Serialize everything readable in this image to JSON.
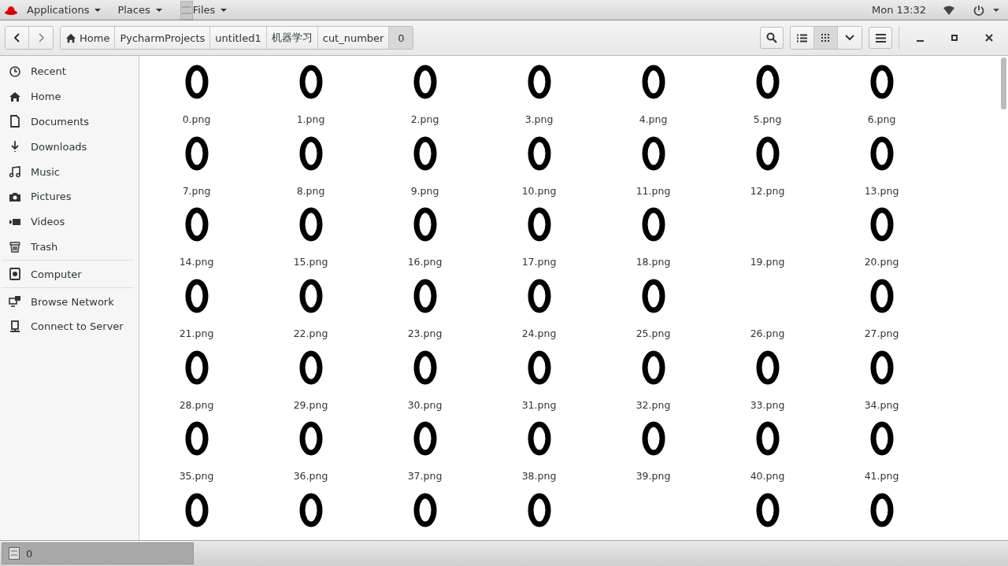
{
  "top_bar": {
    "menus": [
      {
        "label": "Applications"
      },
      {
        "label": "Places"
      },
      {
        "label": "Files"
      }
    ],
    "clock": "Mon 13:32"
  },
  "path_bar": [
    {
      "label": "Home",
      "selected": false
    },
    {
      "label": "PycharmProjects",
      "selected": false
    },
    {
      "label": "untitled1",
      "selected": false
    },
    {
      "label": "机器学习",
      "selected": false
    },
    {
      "label": "cut_number",
      "selected": false
    },
    {
      "label": "0",
      "selected": true
    }
  ],
  "view_buttons": [
    {
      "selected": false
    },
    {
      "selected": true
    }
  ],
  "sidebar": {
    "sections": [
      [
        {
          "label": "Recent"
        },
        {
          "label": "Home"
        },
        {
          "label": "Documents"
        },
        {
          "label": "Downloads"
        },
        {
          "label": "Music"
        },
        {
          "label": "Pictures"
        },
        {
          "label": "Videos"
        },
        {
          "label": "Trash"
        }
      ],
      [
        {
          "label": "Computer"
        }
      ],
      [
        {
          "label": "Browse Network"
        },
        {
          "label": "Connect to Server"
        }
      ]
    ]
  },
  "files": [
    {
      "name": "0.png",
      "kind": "digit"
    },
    {
      "name": "1.png",
      "kind": "digit"
    },
    {
      "name": "2.png",
      "kind": "digit"
    },
    {
      "name": "3.png",
      "kind": "digit"
    },
    {
      "name": "4.png",
      "kind": "digit"
    },
    {
      "name": "5.png",
      "kind": "digit"
    },
    {
      "name": "6.png",
      "kind": "digit"
    },
    {
      "name": "7.png",
      "kind": "digit"
    },
    {
      "name": "8.png",
      "kind": "digit"
    },
    {
      "name": "9.png",
      "kind": "digit"
    },
    {
      "name": "10.png",
      "kind": "digit"
    },
    {
      "name": "11.png",
      "kind": "digit"
    },
    {
      "name": "12.png",
      "kind": "digit"
    },
    {
      "name": "13.png",
      "kind": "digit"
    },
    {
      "name": "14.png",
      "kind": "digit"
    },
    {
      "name": "15.png",
      "kind": "digit"
    },
    {
      "name": "16.png",
      "kind": "digit"
    },
    {
      "name": "17.png",
      "kind": "digit"
    },
    {
      "name": "18.png",
      "kind": "digit"
    },
    {
      "name": "19.png",
      "kind": "blank"
    },
    {
      "name": "20.png",
      "kind": "digit"
    },
    {
      "name": "21.png",
      "kind": "digit"
    },
    {
      "name": "22.png",
      "kind": "digit"
    },
    {
      "name": "23.png",
      "kind": "digit"
    },
    {
      "name": "24.png",
      "kind": "digit"
    },
    {
      "name": "25.png",
      "kind": "digit"
    },
    {
      "name": "26.png",
      "kind": "blank"
    },
    {
      "name": "27.png",
      "kind": "digit"
    },
    {
      "name": "28.png",
      "kind": "digit"
    },
    {
      "name": "29.png",
      "kind": "digit"
    },
    {
      "name": "30.png",
      "kind": "digit"
    },
    {
      "name": "31.png",
      "kind": "digit"
    },
    {
      "name": "32.png",
      "kind": "digit"
    },
    {
      "name": "33.png",
      "kind": "digit"
    },
    {
      "name": "34.png",
      "kind": "digit"
    },
    {
      "name": "35.png",
      "kind": "digit"
    },
    {
      "name": "36.png",
      "kind": "digit"
    },
    {
      "name": "37.png",
      "kind": "digit"
    },
    {
      "name": "38.png",
      "kind": "digit"
    },
    {
      "name": "39.png",
      "kind": "digit"
    },
    {
      "name": "40.png",
      "kind": "digit"
    },
    {
      "name": "41.png",
      "kind": "digit"
    },
    {
      "kind": "digit"
    },
    {
      "kind": "digit"
    },
    {
      "kind": "digit"
    },
    {
      "kind": "digit"
    },
    {
      "kind": "blank"
    },
    {
      "kind": "digit"
    },
    {
      "kind": "digit"
    }
  ],
  "taskbar": {
    "window_button": "0"
  }
}
